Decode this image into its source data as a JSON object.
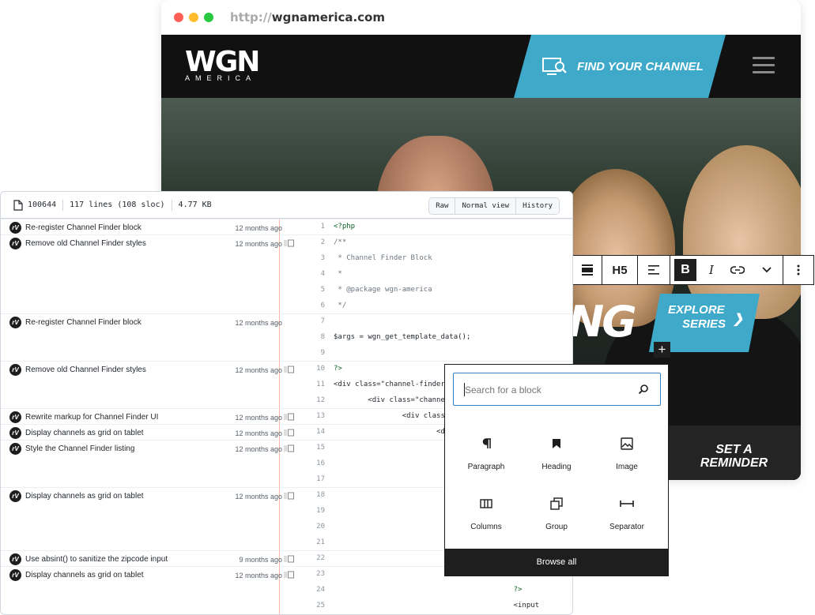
{
  "browser": {
    "dots": [
      "#ff5f57",
      "#febc2e",
      "#28c840"
    ],
    "url_proto": "http://",
    "url_host": "wgnamerica.com"
  },
  "site": {
    "logo_main": "WGN",
    "logo_sub": "AMERICA",
    "find_channel": "FIND YOUR CHANNEL",
    "hero_title_fragment": "NG",
    "explore": [
      "EXPLORE",
      "SERIES"
    ],
    "reminder": [
      "SET A",
      "REMINDER"
    ],
    "accent": "#3ea9c9"
  },
  "block_toolbar": {
    "heading_level": "H5",
    "bold": "B",
    "italic": "I"
  },
  "file": {
    "mode": "100644",
    "lines": "117 lines (108 sloc)",
    "size": "4.77 KB",
    "buttons": [
      "Raw",
      "Normal view",
      "History"
    ]
  },
  "blame": [
    {
      "msg": "Re-register Channel Finder block",
      "age": "12 months ago",
      "lines": [
        {
          "n": "1",
          "code": "<?php",
          "cls": "k"
        }
      ]
    },
    {
      "msg": "Remove old Channel Finder styles",
      "age": "12 months ago",
      "lines": [
        {
          "n": "2",
          "code": "/**",
          "cls": "c"
        },
        {
          "n": "3",
          "code": " * Channel Finder Block",
          "cls": "c"
        },
        {
          "n": "4",
          "code": " *",
          "cls": "c"
        },
        {
          "n": "5",
          "code": " * @package wgn-america",
          "cls": "c"
        },
        {
          "n": "6",
          "code": " */",
          "cls": "c"
        }
      ]
    },
    {
      "msg": "Re-register Channel Finder block",
      "age": "12 months ago",
      "lines": [
        {
          "n": "7",
          "code": "",
          "cls": "v"
        },
        {
          "n": "8",
          "code": "$args = wgn_get_template_data();",
          "cls": "v"
        },
        {
          "n": "9",
          "code": "",
          "cls": "v"
        }
      ]
    },
    {
      "msg": "Remove old Channel Finder styles",
      "age": "12 months ago",
      "lines": [
        {
          "n": "10",
          "code": "?>",
          "cls": "k"
        },
        {
          "n": "11",
          "code": "<div class=\"channel-finder",
          "cls": "v"
        },
        {
          "n": "12",
          "code": "        <div class=\"channe",
          "cls": "v"
        }
      ]
    },
    {
      "msg": "Rewrite markup for Channel Finder UI",
      "age": "12 months ago",
      "lines": [
        {
          "n": "13",
          "code": "                <div class",
          "cls": "v"
        }
      ]
    },
    {
      "msg": "Display channels as grid on tablet",
      "age": "12 months ago",
      "lines": [
        {
          "n": "14",
          "code": "                        <d",
          "cls": "v"
        }
      ]
    },
    {
      "msg": "Style the Channel Finder listing",
      "age": "12 months ago",
      "lines": [
        {
          "n": "15",
          "code": "",
          "cls": "v"
        },
        {
          "n": "16",
          "code": "",
          "cls": "v"
        },
        {
          "n": "17",
          "code": "",
          "cls": "v"
        }
      ]
    },
    {
      "msg": "Display channels as grid on tablet",
      "age": "12 months ago",
      "lines": [
        {
          "n": "18",
          "code": "",
          "cls": "v"
        },
        {
          "n": "19",
          "code": "",
          "cls": "v"
        },
        {
          "n": "20",
          "code": "",
          "cls": "v"
        },
        {
          "n": "21",
          "code": "",
          "cls": "v"
        }
      ]
    },
    {
      "msg": "Use absint() to sanitize the zipcode input",
      "age": "9 months ago",
      "lines": [
        {
          "n": "22",
          "code": "",
          "cls": "v"
        }
      ]
    },
    {
      "msg": "Display channels as grid on tablet",
      "age": "12 months ago",
      "lines": [
        {
          "n": "23",
          "code": "                                          )",
          "cls": "v"
        },
        {
          "n": "24",
          "code": "                                          ?>",
          "cls": "k"
        },
        {
          "n": "25",
          "code": "                                          <input",
          "cls": "v"
        }
      ]
    }
  ],
  "inserter": {
    "search_placeholder": "Search for a block",
    "blocks": [
      {
        "label": "Paragraph",
        "icon": "paragraph-icon"
      },
      {
        "label": "Heading",
        "icon": "heading-icon"
      },
      {
        "label": "Image",
        "icon": "image-icon"
      },
      {
        "label": "Columns",
        "icon": "columns-icon"
      },
      {
        "label": "Group",
        "icon": "group-icon"
      },
      {
        "label": "Separator",
        "icon": "separator-icon"
      }
    ],
    "browse_all": "Browse all"
  }
}
